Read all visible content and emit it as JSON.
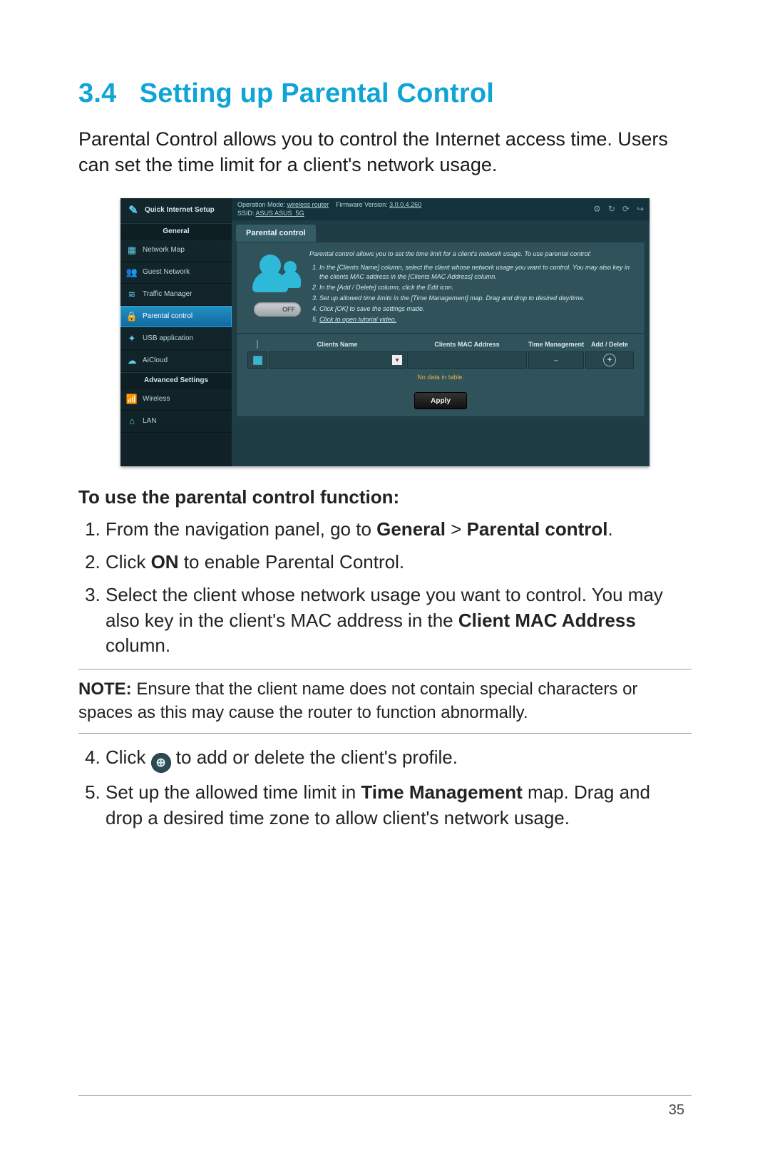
{
  "section": {
    "number": "3.4",
    "title": "Setting up Parental Control"
  },
  "intro": "Parental Control allows you to control the Internet access time. Users can set the time limit for a client's network usage.",
  "screenshot": {
    "sidebar": {
      "qis": "Quick Internet Setup",
      "group_general": "General",
      "group_advanced": "Advanced Settings",
      "items": [
        {
          "label": "Network Map",
          "glyph": "▦"
        },
        {
          "label": "Guest Network",
          "glyph": "👥"
        },
        {
          "label": "Traffic Manager",
          "glyph": "≋"
        },
        {
          "label": "Parental control",
          "glyph": "🔒",
          "active": true
        },
        {
          "label": "USB application",
          "glyph": "✦"
        },
        {
          "label": "AiCloud",
          "glyph": "☁"
        }
      ],
      "adv": [
        {
          "label": "Wireless",
          "glyph": "📶"
        },
        {
          "label": "LAN",
          "glyph": "⌂"
        }
      ]
    },
    "topbar": {
      "op_mode_label": "Operation Mode:",
      "op_mode": "wireless router",
      "fw_label": "Firmware Version:",
      "fw": "3.0.0.4.260",
      "ssid_label": "SSID:",
      "ssid": "ASUS  ASUS_5G"
    },
    "tab": "Parental control",
    "help_intro": "Parental control allows you to set the time limit for a client's network usage. To use parental control:",
    "help_steps": [
      "In the [Clients Name] column, select the client whose network usage you want to control. You may also key in the clients MAC address in the [Clients MAC Address] column.",
      "In the [Add / Delete] column, click the Edit icon.",
      "Set up allowed time limits in the [Time Management] map. Drag and drop to desired day/time.",
      "Click [OK] to save the settings made.",
      "Click to open tutorial video."
    ],
    "toggle": "OFF",
    "table": {
      "h1": "Clients Name",
      "h2": "Clients MAC Address",
      "h3": "Time Management",
      "h4": "Add / Delete",
      "dash": "–",
      "empty": "No data in table."
    },
    "apply": "Apply"
  },
  "sub": "To use the parental control function:",
  "steps123": [
    {
      "pre": "From the navigation panel, go to ",
      "b1": "General",
      "mid": " > ",
      "b2": "Parental control",
      "post": "."
    },
    {
      "pre": "Click ",
      "b1": "ON",
      "post": " to enable Parental Control."
    },
    {
      "pre": "Select the client whose network usage you want to control. You may also key in the client's MAC address in the ",
      "b1": "Client MAC Address",
      "post": " column."
    }
  ],
  "note": {
    "label": "NOTE:",
    "text": "  Ensure that the client name does not contain special characters or spaces as this may cause the router to function abnormally."
  },
  "steps45": [
    {
      "n": "4",
      "pre": "Click ",
      "post": " to add or delete the client's profile."
    },
    {
      "n": "5",
      "pre": "Set up the allowed time limit in ",
      "b1": "Time Management",
      "post": " map. Drag and drop a desired time zone to allow client's network usage."
    }
  ],
  "page_number": "35"
}
